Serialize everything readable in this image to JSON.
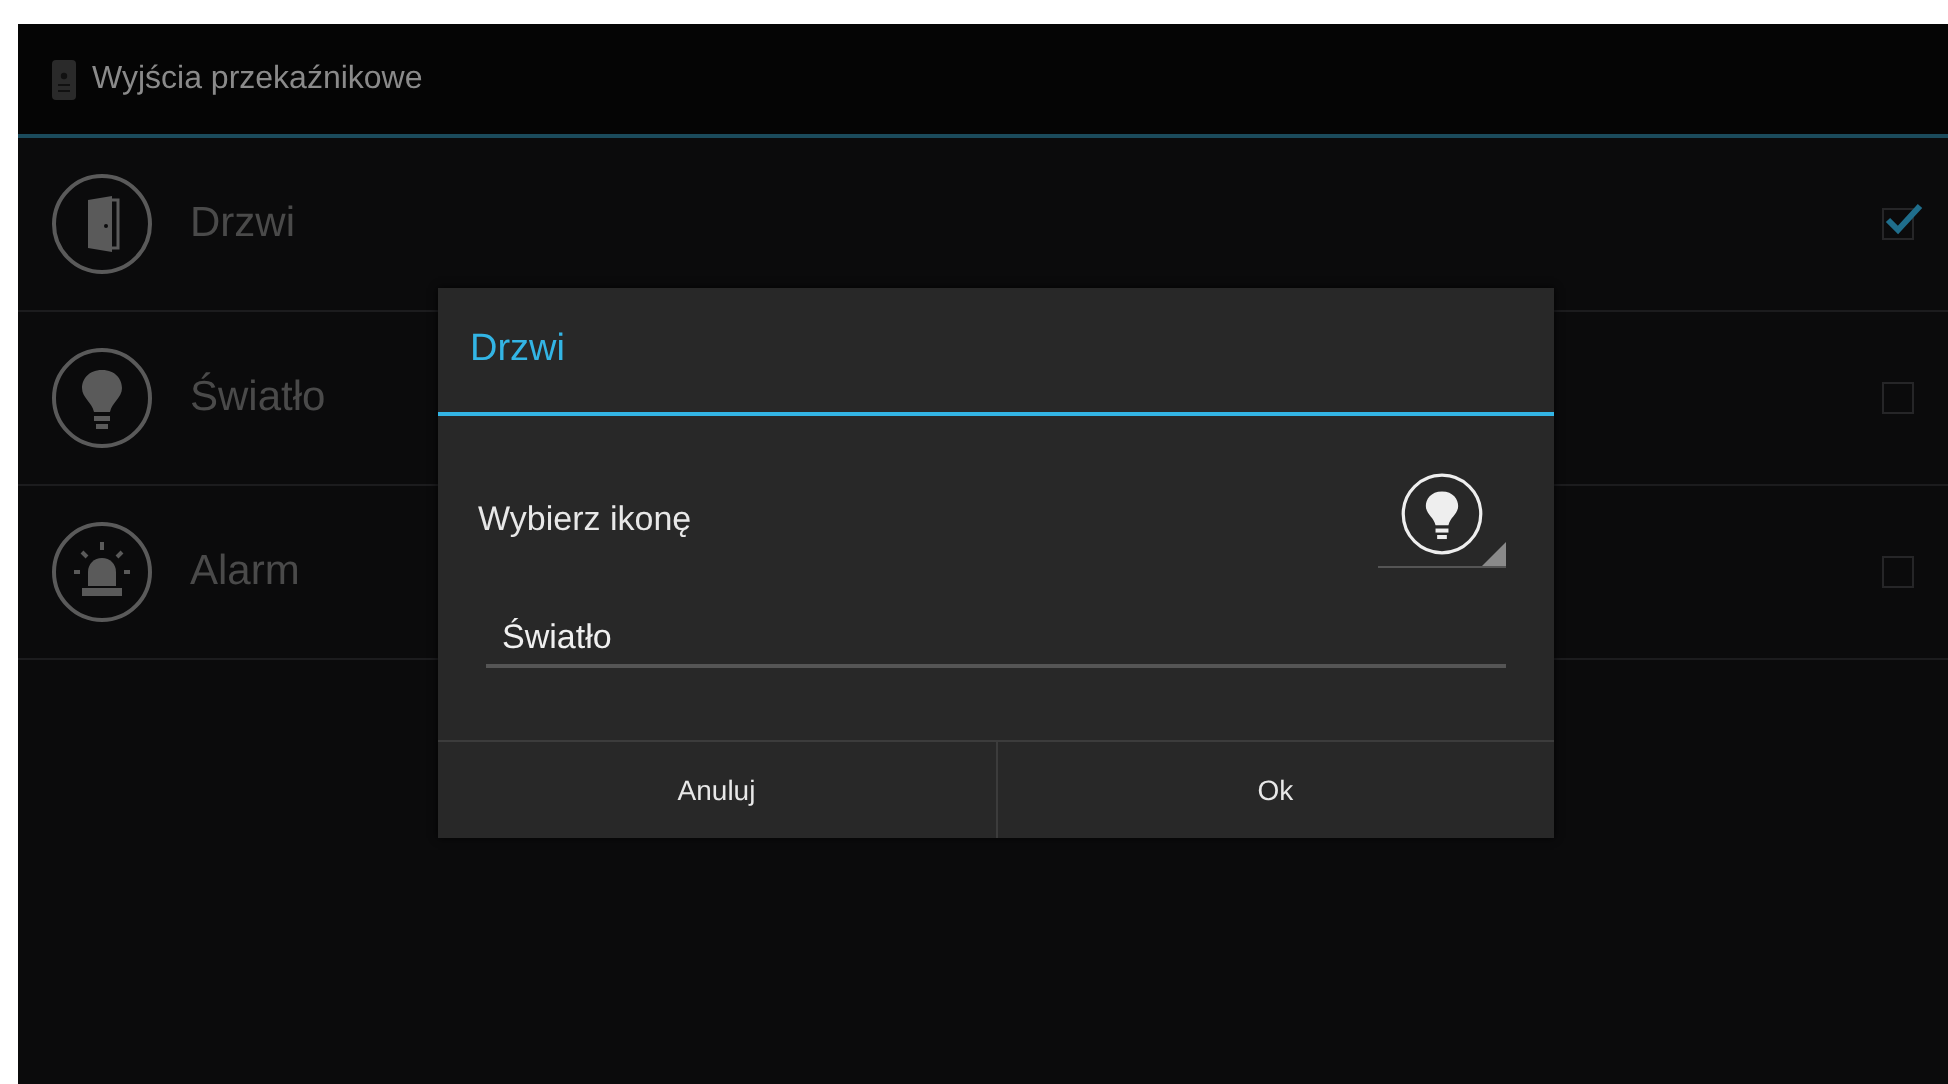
{
  "action_bar": {
    "title": "Wyjścia przekaźnikowe"
  },
  "outputs": [
    {
      "name": "Drzwi",
      "checked": true
    },
    {
      "name": "Światło",
      "checked": false
    },
    {
      "name": "Alarm",
      "checked": false
    }
  ],
  "dialog": {
    "title": "Drzwi",
    "icon_label": "Wybierz ikonę",
    "name_field": {
      "value": "Światło"
    },
    "buttons": [
      "Anuluj",
      "Ok"
    ]
  }
}
